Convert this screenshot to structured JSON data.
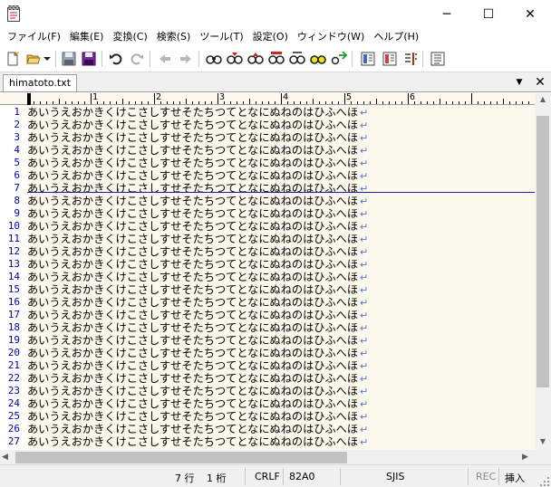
{
  "window": {
    "minimize_glyph": "─",
    "maximize_glyph": "☐",
    "close_glyph": "✕"
  },
  "menu": {
    "items": [
      "ファイル(F)",
      "編集(E)",
      "変換(C)",
      "検索(S)",
      "ツール(T)",
      "設定(O)",
      "ウィンドウ(W)",
      "ヘルプ(H)"
    ]
  },
  "toolbar": {
    "icons": [
      "new-file-icon",
      "open-file-icon",
      "dropdown-arrow-icon",
      "save-icon",
      "save-all-icon",
      "undo-icon",
      "redo-icon",
      "jump-back-icon",
      "jump-forward-icon",
      "search-icon",
      "search-prev-icon",
      "search-next-icon",
      "search-highlight-icon",
      "replace-icon",
      "mark-clear-icon",
      "grep-icon",
      "outline-icon",
      "toggle-view-icon",
      "compare-icon",
      "settings-list-icon"
    ]
  },
  "tabs": [
    {
      "label": "himatoto.txt",
      "active": true
    }
  ],
  "tab_controls": {
    "dropdown_glyph": "▼",
    "close_glyph": "✕"
  },
  "ruler": {
    "labels": [
      "1",
      "2",
      "3",
      "4",
      "5",
      "6"
    ]
  },
  "editor": {
    "line_text": "あいうえおかきくけこさしすせそたちつてとなにぬねのはひふへほ",
    "eol_glyph": "↵",
    "visible_line_numbers": [
      "1",
      "2",
      "3",
      "4",
      "5",
      "6",
      "7",
      "8",
      "9",
      "10",
      "11",
      "12",
      "13",
      "14",
      "15",
      "16",
      "17",
      "18",
      "19",
      "20",
      "21",
      "22",
      "23",
      "24",
      "25",
      "26",
      "27"
    ],
    "cursor_line": 7
  },
  "status": {
    "row": "7 行",
    "col": "1 桁",
    "eol": "CRLF",
    "char_code": "82A0",
    "encoding": "SJIS",
    "rec": "REC",
    "mode": "挿入"
  },
  "colors": {
    "editor_bg": "#fdf8ec",
    "line_number": "#0000c0",
    "cursor_line": "#1a1ab4",
    "eol_mark": "#4a7ad8"
  }
}
